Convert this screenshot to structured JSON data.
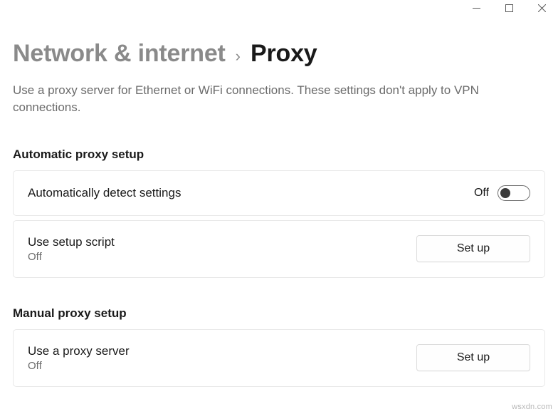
{
  "titlebar": {
    "minimize": "minimize",
    "maximize": "maximize",
    "close": "close"
  },
  "breadcrumb": {
    "parent": "Network & internet",
    "separator": "›",
    "current": "Proxy"
  },
  "description": "Use a proxy server for Ethernet or WiFi connections. These settings don't apply to VPN connections.",
  "sections": {
    "automatic": {
      "heading": "Automatic proxy setup",
      "items": [
        {
          "title": "Automatically detect settings",
          "toggle_state_label": "Off"
        },
        {
          "title": "Use setup script",
          "sub": "Off",
          "button_label": "Set up"
        }
      ]
    },
    "manual": {
      "heading": "Manual proxy setup",
      "items": [
        {
          "title": "Use a proxy server",
          "sub": "Off",
          "button_label": "Set up"
        }
      ]
    }
  },
  "watermark": "wsxdn.com"
}
